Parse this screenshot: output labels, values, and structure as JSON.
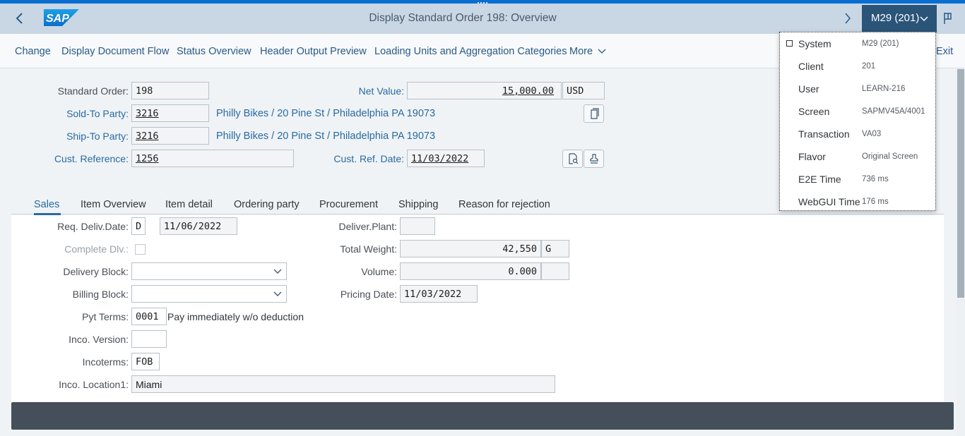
{
  "shell": {
    "title": "Display Standard Order 198: Overview",
    "system_button": "M29 (201)",
    "logo_text": "SAP"
  },
  "toolbar": {
    "items": [
      "Change",
      "Display Document Flow",
      "Status Overview",
      "Header Output Preview",
      "Loading Units and Aggregation Categories",
      "More"
    ],
    "exit": "Exit"
  },
  "header": {
    "standard_order_label": "Standard Order:",
    "standard_order": "198",
    "net_value_label": "Net Value:",
    "net_value": "15,000.00",
    "currency": "USD",
    "sold_to_label": "Sold-To Party:",
    "sold_to": "3216",
    "sold_to_text": "Philly Bikes / 20 Pine St / Philadelphia PA 19073",
    "ship_to_label": "Ship-To Party:",
    "ship_to": "3216",
    "ship_to_text": "Philly Bikes / 20 Pine St / Philadelphia PA 19073",
    "cust_ref_label": "Cust. Reference:",
    "cust_ref": "1256",
    "cust_ref_date_label": "Cust. Ref. Date:",
    "cust_ref_date": "11/03/2022"
  },
  "tabs": [
    "Sales",
    "Item Overview",
    "Item detail",
    "Ordering party",
    "Procurement",
    "Shipping",
    "Reason for rejection"
  ],
  "sales": {
    "req_deliv_label": "Req. Deliv.Date:",
    "req_deliv_type": "D",
    "req_deliv_date": "11/06/2022",
    "complete_dlv_label": "Complete Dlv.:",
    "delivery_block_label": "Delivery Block:",
    "billing_block_label": "Billing Block:",
    "pyt_terms_label": "Pyt Terms:",
    "pyt_terms": "0001",
    "pyt_terms_text": "Pay immediately w/o deduction",
    "inco_version_label": "Inco. Version:",
    "incoterms_label": "Incoterms:",
    "incoterms": "FOB",
    "inco_location_label": "Inco. Location1:",
    "inco_location": "Miami",
    "deliver_plant_label": "Deliver.Plant:",
    "total_weight_label": "Total Weight:",
    "total_weight": "42,550",
    "weight_unit": "G",
    "volume_label": "Volume:",
    "volume": "0.000",
    "pricing_date_label": "Pricing Date:",
    "pricing_date": "11/03/2022"
  },
  "system_info": [
    {
      "key": "System",
      "value": "M29 (201)"
    },
    {
      "key": "Client",
      "value": "201"
    },
    {
      "key": "User",
      "value": "LEARN-216"
    },
    {
      "key": "Screen",
      "value": "SAPMV45A/4001"
    },
    {
      "key": "Transaction",
      "value": "VA03"
    },
    {
      "key": "Flavor",
      "value": "Original Screen"
    },
    {
      "key": "E2E Time",
      "value": "736 ms"
    },
    {
      "key": "WebGUI Time",
      "value": "176 ms"
    }
  ],
  "colors": {
    "shell": "#c9d7e5",
    "accent": "#0a6ed1",
    "system_button": "#2a5478",
    "link": "#2a6aa0"
  },
  "icons": [
    "back-icon",
    "forward-icon",
    "chevron-down-icon",
    "flag-icon",
    "copy-icon",
    "document-search-icon",
    "stamp-icon"
  ]
}
